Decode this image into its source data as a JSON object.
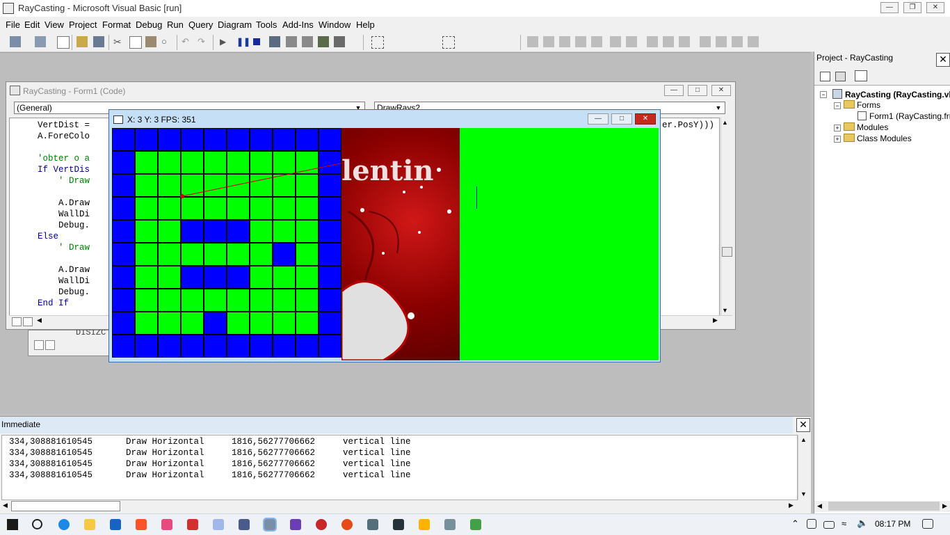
{
  "app": {
    "title": "RayCasting - Microsoft Visual Basic [run]"
  },
  "menu": [
    "File",
    "Edit",
    "View",
    "Project",
    "Format",
    "Debug",
    "Run",
    "Query",
    "Diagram",
    "Tools",
    "Add-Ins",
    "Window",
    "Help"
  ],
  "code_window": {
    "title": "RayCasting - Form1 (Code)",
    "object_combo": "(General)",
    "proc_combo": "DrawRays2",
    "lines": [
      "    VertDist = ",
      "    A.ForeColo",
      "",
      "    'obter o a",
      "    If VertDis",
      "        ' Draw",
      "",
      "        A.Draw",
      "        WallDi",
      "        Debug.",
      "    Else",
      "        ' Draw",
      "",
      "        A.Draw",
      "        WallDi",
      "        Debug.",
      "    End If"
    ],
    "right_fragment": "er.PosY)))",
    "behind_fragment": "DISIZC"
  },
  "game_window": {
    "title": "X:  3  Y:  3 FPS:  351",
    "valentine_text": "lentin",
    "map": [
      [
        1,
        1,
        1,
        1,
        1,
        1,
        1,
        1,
        1,
        1
      ],
      [
        1,
        0,
        0,
        0,
        0,
        0,
        0,
        0,
        0,
        1
      ],
      [
        1,
        0,
        0,
        0,
        0,
        0,
        0,
        0,
        0,
        1
      ],
      [
        1,
        0,
        0,
        0,
        0,
        0,
        0,
        0,
        0,
        1
      ],
      [
        1,
        0,
        0,
        1,
        1,
        1,
        0,
        0,
        0,
        1
      ],
      [
        1,
        0,
        0,
        0,
        0,
        0,
        0,
        1,
        0,
        1
      ],
      [
        1,
        0,
        0,
        1,
        1,
        1,
        0,
        0,
        0,
        1
      ],
      [
        1,
        0,
        0,
        0,
        0,
        0,
        0,
        0,
        0,
        1
      ],
      [
        1,
        0,
        0,
        0,
        1,
        0,
        0,
        0,
        0,
        1
      ],
      [
        1,
        1,
        1,
        1,
        1,
        1,
        1,
        1,
        1,
        1
      ]
    ],
    "colors": {
      "wall": "#0000ff",
      "floor": "#00ff00",
      "ray": "#cc0000"
    }
  },
  "immediate": {
    "title": "Immediate",
    "rows": [
      [
        "334,308881610545",
        "Draw Horizontal",
        "1816,56277706662",
        "vertical line"
      ],
      [
        "334,308881610545",
        "Draw Horizontal",
        "1816,56277706662",
        "vertical line"
      ],
      [
        "334,308881610545",
        "Draw Horizontal",
        "1816,56277706662",
        "vertical line"
      ],
      [
        "334,308881610545",
        "Draw Horizontal",
        "1816,56277706662",
        "vertical line"
      ]
    ]
  },
  "project": {
    "title": "Project - RayCasting",
    "root": "RayCasting (RayCasting.vbp)",
    "items": [
      {
        "label": "Forms",
        "type": "folder",
        "expanded": true
      },
      {
        "label": "Form1 (RayCasting.frm)",
        "type": "form"
      },
      {
        "label": "Modules",
        "type": "folder",
        "expanded": false
      },
      {
        "label": "Class Modules",
        "type": "folder",
        "expanded": false
      }
    ]
  },
  "taskbar": {
    "time": "08:17 PM"
  }
}
